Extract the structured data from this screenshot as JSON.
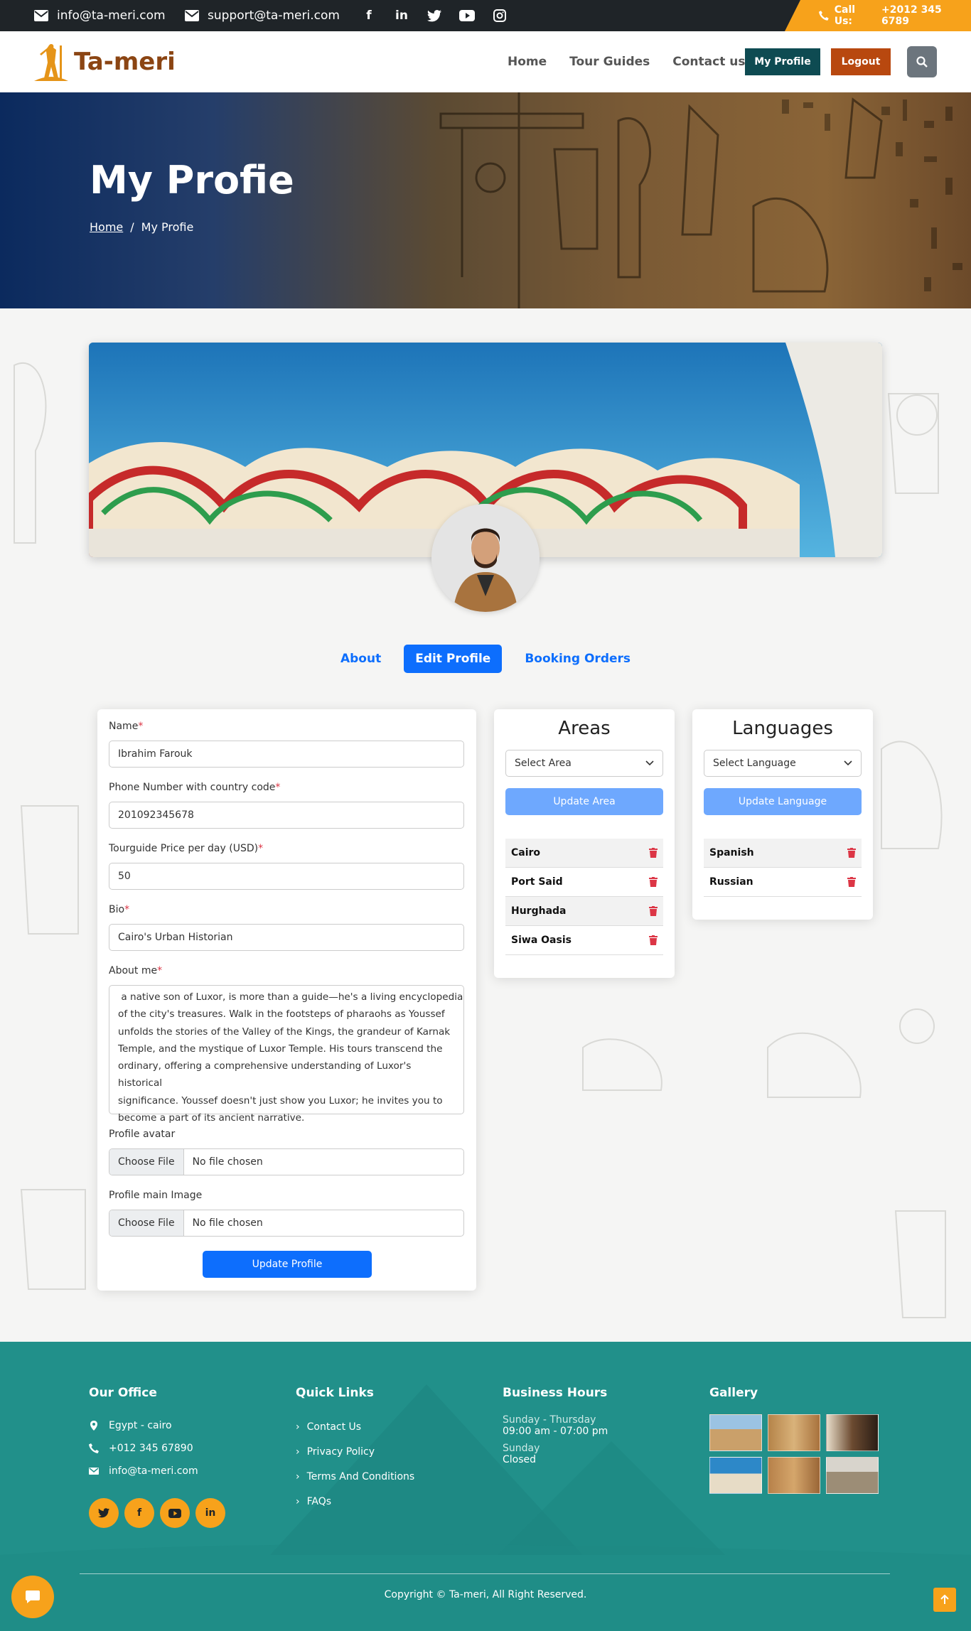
{
  "topbar": {
    "email1": "info@ta-meri.com",
    "email2": "support@ta-meri.com",
    "social": [
      "f",
      "in",
      "t",
      "yt",
      "ig"
    ],
    "call_label": "Call Us:",
    "call_number": "+2012 345 6789",
    "accent": "#f7a21b"
  },
  "nav": {
    "brand": "Ta-meri",
    "links": [
      "Home",
      "Tour Guides",
      "Contact us"
    ],
    "my_profile": "My Profile",
    "logout": "Logout",
    "search_icon": "search-icon"
  },
  "hero": {
    "title": "My Profie",
    "breadcrumb_home": "Home",
    "breadcrumb_sep": "/",
    "breadcrumb_current": "My Profie"
  },
  "tabs": {
    "about": "About",
    "edit": "Edit Profile",
    "bookings": "Booking Orders",
    "active": "Edit Profile"
  },
  "form": {
    "name_label": "Name",
    "name_value": "Ibrahim Farouk",
    "phone_label": "Phone Number with country code",
    "phone_value": "201092345678",
    "price_label": "Tourguide Price per day (USD)",
    "price_value": "50",
    "bio_label": "Bio",
    "bio_value": "Cairo's Urban Historian",
    "about_label": "About me",
    "about_lines": [
      " a native son of Luxor, is more than a guide—he's a living encyclopedia",
      "of the city's treasures. Walk in the footsteps of pharaohs as Youssef",
      "unfolds the stories of the Valley of the Kings, the grandeur of Karnak",
      "Temple, and the mystique of Luxor Temple. His tours transcend the",
      "ordinary, offering a comprehensive understanding of Luxor's historical",
      "significance. Youssef doesn't just show you Luxor; he invites you to",
      "become a part of its ancient narrative."
    ],
    "avatar_label": "Profile avatar",
    "main_image_label": "Profile main Image",
    "choose_file": "Choose File",
    "no_file": "No file chosen",
    "required_mark": "*",
    "submit": "Update Profile"
  },
  "areas": {
    "title": "Areas",
    "select_placeholder": "Select Area",
    "update": "Update Area",
    "items": [
      "Cairo",
      "Port Said",
      "Hurghada",
      "Siwa Oasis"
    ]
  },
  "languages": {
    "title": "Languages",
    "select_placeholder": "Select Language",
    "update": "Update Language",
    "items": [
      "Spanish",
      "Russian"
    ]
  },
  "footer": {
    "office_title": "Our Office",
    "address": "Egypt - cairo",
    "phone": "+012 345 67890",
    "email": "info@ta-meri.com",
    "social": [
      "t",
      "f",
      "▶",
      "in"
    ],
    "quick_title": "Quick Links",
    "quick_links": [
      "Contact Us",
      "Privacy Policy",
      "Terms And Conditions",
      "FAQs"
    ],
    "hours_title": "Business Hours",
    "weekdays": "Sunday - Thursday",
    "weekday_hours": "09:00 am - 07:00 pm",
    "weekend": "Sunday",
    "weekend_hours": "Closed",
    "gallery_title": "Gallery",
    "copyright": "Copyright © Ta-meri, All Right Reserved.",
    "bg_color": "#21908a"
  }
}
